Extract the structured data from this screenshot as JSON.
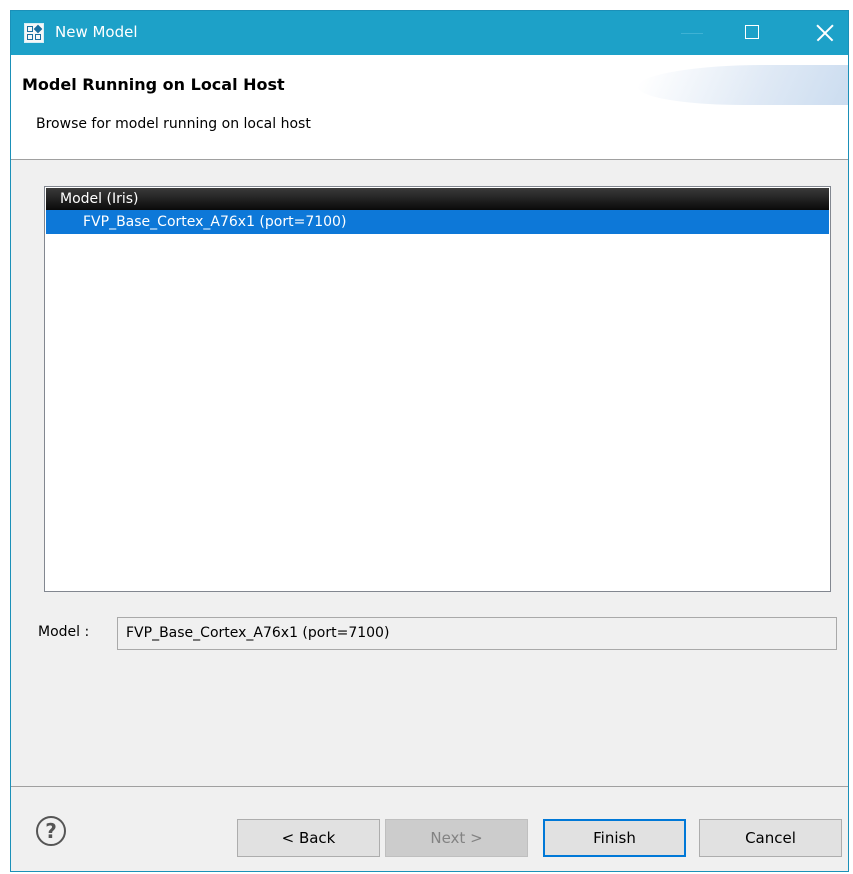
{
  "window": {
    "title": "New Model",
    "icon": "model-wizard-icon",
    "controls": {
      "minimize_icon": "minimize-icon",
      "maximize_icon": "maximize-icon",
      "close_icon": "close-icon"
    }
  },
  "header": {
    "title": "Model Running on Local Host",
    "description": "Browse for model running on local host"
  },
  "model_list": {
    "column_header": "Model (Iris)",
    "rows": [
      {
        "label": "FVP_Base_Cortex_A76x1 (port=7100)",
        "selected": true
      }
    ]
  },
  "model_field": {
    "label": "Model :",
    "value": "FVP_Base_Cortex_A76x1 (port=7100)"
  },
  "buttons": {
    "help_icon": "help-icon",
    "back": "< Back",
    "next": "Next >",
    "finish": "Finish",
    "cancel": "Cancel"
  },
  "colors": {
    "titlebar": "#1da1c8",
    "selection": "#0d78d8",
    "default_button_border": "#0078d7"
  }
}
